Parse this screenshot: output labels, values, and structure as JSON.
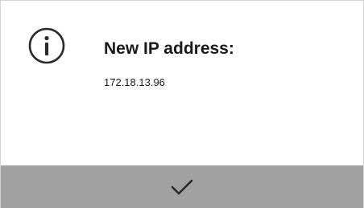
{
  "dialog": {
    "icon": "info-circle-icon",
    "title": "New IP address:",
    "ip_address": "172.18.13.96",
    "confirm_icon": "checkmark-icon",
    "colors": {
      "background": "#ffffff",
      "footer": "#a1a1a1",
      "text": "#1a1a1a",
      "icon": "#2a2a2a"
    }
  }
}
